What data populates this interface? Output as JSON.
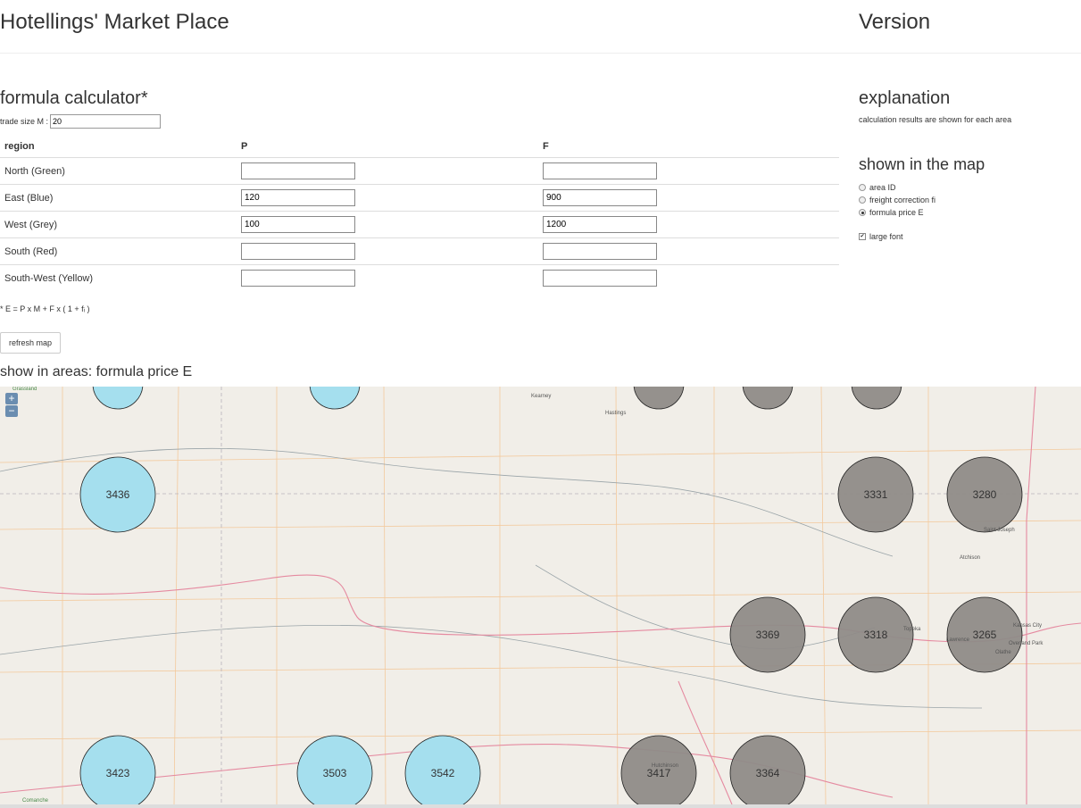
{
  "header": {
    "title": "Hotellings' Market Place",
    "version": "Version"
  },
  "calculator": {
    "title": "formula calculator*",
    "trade_size_label": "trade size M :",
    "trade_size_value": "20",
    "columns": [
      "region",
      "P",
      "F"
    ],
    "rows": [
      {
        "region": "North (Green)",
        "p": "",
        "f": ""
      },
      {
        "region": "East (Blue)",
        "p": "120",
        "f": "900"
      },
      {
        "region": "West (Grey)",
        "p": "100",
        "f": "1200"
      },
      {
        "region": "South (Red)",
        "p": "",
        "f": ""
      },
      {
        "region": "South-West (Yellow)",
        "p": "",
        "f": ""
      }
    ],
    "formula_note": "* E = P x M + F x ( 1 + fᵢ )",
    "refresh_label": "refresh map"
  },
  "show_in_areas": "show in areas: formula price E",
  "sidebar": {
    "explanation_title": "explanation",
    "explanation_text": "calculation results are shown for each area",
    "shown_title": "shown in the map",
    "options": [
      {
        "label": "area ID",
        "selected": false
      },
      {
        "label": "freight correction fi",
        "selected": false
      },
      {
        "label": "formula price E",
        "selected": true
      }
    ],
    "large_font_label": "large font",
    "large_font_checked": true
  },
  "map": {
    "zoom_in": "+",
    "zoom_out": "−",
    "place_labels": [
      "Kearney",
      "Hastings",
      "Saint Joseph",
      "Atchison",
      "Kansas City",
      "Topeka",
      "Lawrence",
      "Olathe",
      "Overland Park",
      "Hutchinson",
      "Grassland",
      "Comanche"
    ],
    "circle_labels": [
      "3436",
      "3331",
      "3280",
      "3369",
      "3318",
      "3265",
      "3423",
      "3503",
      "3542",
      "3417",
      "3364"
    ],
    "colors": {
      "blue": "#a5dfee",
      "grey": "#8f8b88",
      "map_bg": "#f1eee8",
      "road_red": "#e58aa0",
      "road_orange": "#f3c99c"
    }
  }
}
